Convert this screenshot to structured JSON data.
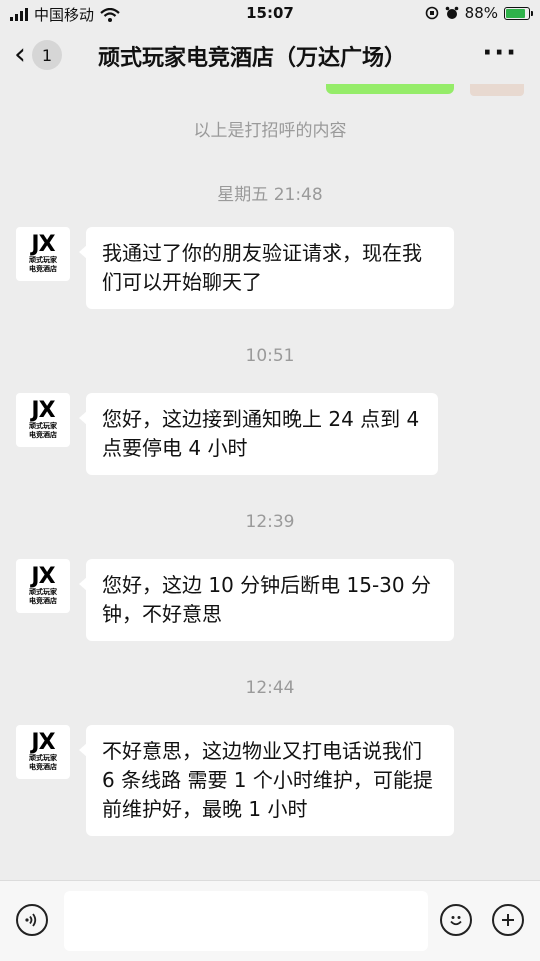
{
  "status_bar": {
    "carrier": "中国移动",
    "time": "15:07",
    "battery": "88%"
  },
  "header": {
    "unread_count": "1",
    "title": "顽式玩家电竞酒店（万达广场）"
  },
  "system_notice": "以上是打招呼的内容",
  "contact_avatar": {
    "logo_text": "JX",
    "sub_text": "顽式玩家\n电竞酒店"
  },
  "messages": [
    {
      "time": "星期五 21:48",
      "text": "我通过了你的朋友验证请求，现在我们可以开始聊天了"
    },
    {
      "time": "10:51",
      "text": "您好，这边接到通知晚上 24 点到 4 点要停电 4 小时"
    },
    {
      "time": "12:39",
      "text": "您好，这边 10 分钟后断电 15-30 分钟，不好意思"
    },
    {
      "time": "12:44",
      "text": "不好意思，这边物业又打电话说我们 6 条线路 需要 1 个小时维护，可能提前维护好，最晚 1 小时"
    }
  ],
  "input": {
    "value": ""
  },
  "icons": {
    "signal": "signal-icon",
    "wifi": "wifi-icon",
    "alarm": "alarm-icon",
    "battery": "battery-icon",
    "voice": "voice-icon",
    "emoji": "emoji-icon",
    "add": "add-icon"
  },
  "colors": {
    "background": "#ededed",
    "bubble": "#ffffff",
    "own_bubble": "#95ec69",
    "battery": "#2fb24a"
  }
}
